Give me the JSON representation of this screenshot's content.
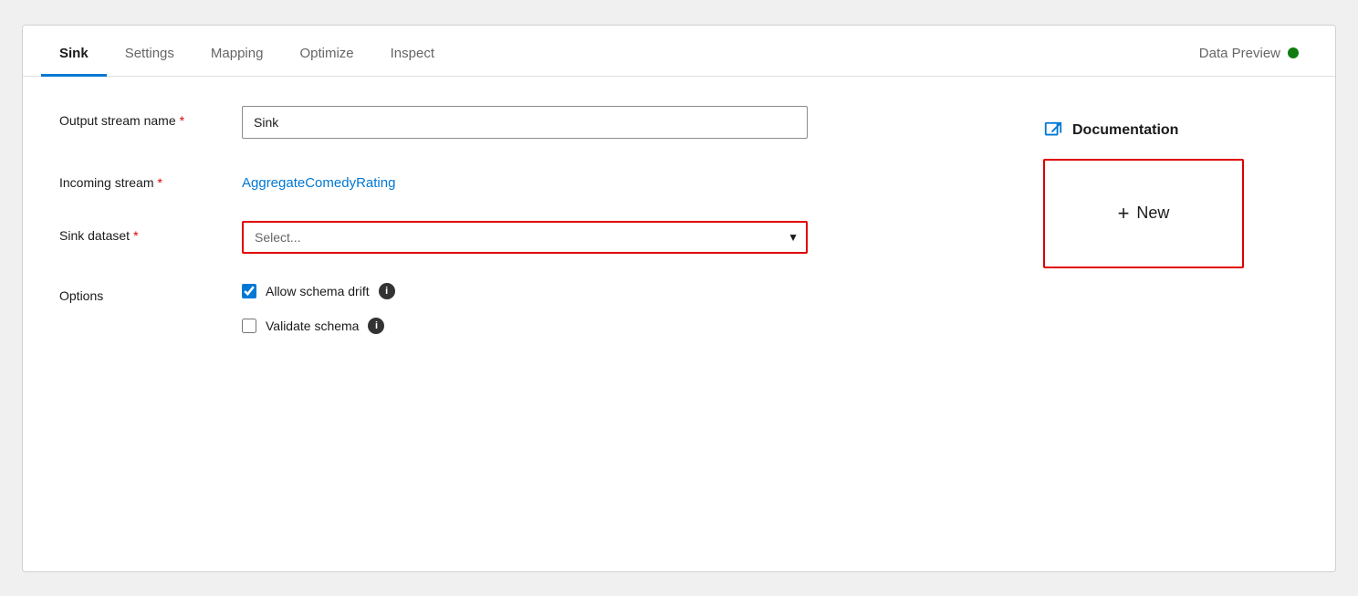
{
  "tabs": [
    {
      "id": "sink",
      "label": "Sink",
      "active": true
    },
    {
      "id": "settings",
      "label": "Settings",
      "active": false
    },
    {
      "id": "mapping",
      "label": "Mapping",
      "active": false
    },
    {
      "id": "optimize",
      "label": "Optimize",
      "active": false
    },
    {
      "id": "inspect",
      "label": "Inspect",
      "active": false
    },
    {
      "id": "data-preview",
      "label": "Data Preview",
      "active": false
    }
  ],
  "data_preview_status": "active",
  "form": {
    "output_stream_name_label": "Output stream name",
    "output_stream_name_value": "Sink",
    "incoming_stream_label": "Incoming stream",
    "incoming_stream_value": "AggregateComedyRating",
    "sink_dataset_label": "Sink dataset",
    "sink_dataset_placeholder": "Select...",
    "options_label": "Options",
    "allow_schema_drift_label": "Allow schema drift",
    "validate_schema_label": "Validate schema"
  },
  "documentation": {
    "label": "Documentation",
    "icon_title": "external-link"
  },
  "new_button": {
    "plus_symbol": "+",
    "label": "New"
  },
  "required_star": "*"
}
